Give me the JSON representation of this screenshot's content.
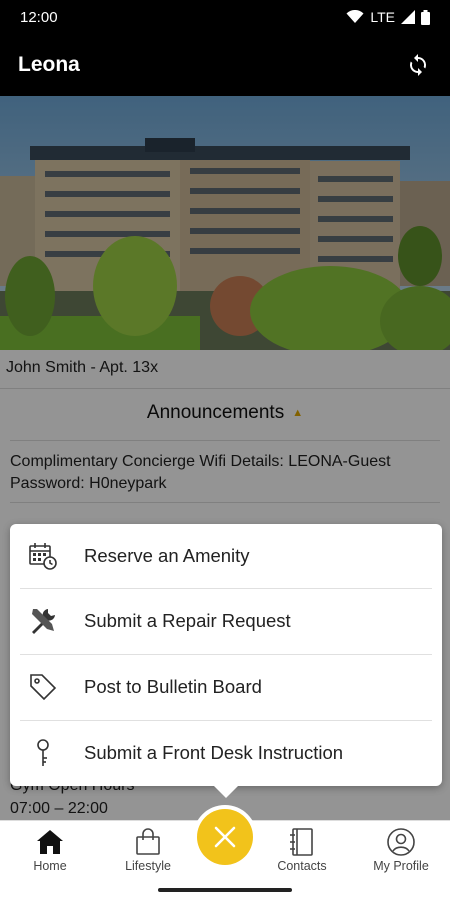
{
  "status_bar": {
    "time": "12:00",
    "network": "LTE"
  },
  "app_bar": {
    "title": "Leona"
  },
  "resident": {
    "label": "John Smith - Apt. 13x"
  },
  "announcements": {
    "title": "Announcements",
    "items": [
      {
        "text": "Complimentary Concierge Wifi Details: LEONA-Guest Password: H0neypark"
      }
    ]
  },
  "gym": {
    "title": "Gym Open Hours",
    "hours": "07:00 – 22:00"
  },
  "menu": {
    "items": [
      {
        "label": "Reserve an Amenity",
        "icon": "calendar-clock-icon"
      },
      {
        "label": "Submit a Repair Request",
        "icon": "tools-icon"
      },
      {
        "label": "Post to Bulletin Board",
        "icon": "tag-icon"
      },
      {
        "label": "Submit a Front Desk Instruction",
        "icon": "key-icon"
      }
    ]
  },
  "bottom_nav": {
    "items": [
      {
        "label": "Home",
        "icon": "home-icon"
      },
      {
        "label": "Lifestyle",
        "icon": "shopping-bag-icon"
      },
      {
        "label": "Contacts",
        "icon": "contacts-book-icon"
      },
      {
        "label": "My Profile",
        "icon": "profile-icon"
      }
    ]
  },
  "colors": {
    "accent": "#f2c31b",
    "app_bar": "#000000"
  }
}
